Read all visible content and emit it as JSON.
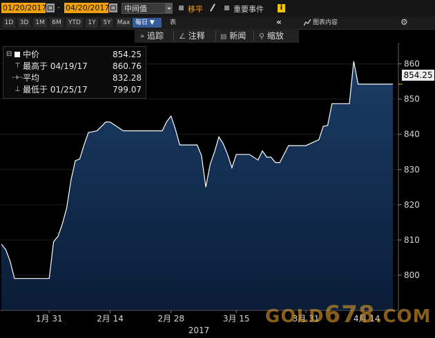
{
  "toolbar": {
    "start_date": "01/20/2017",
    "end_date": "04/20/2017",
    "dash": "-",
    "price_mode": "中间值",
    "move_label": "移平",
    "events_label": "重要事件",
    "info_label": "i"
  },
  "range_buttons": [
    "1D",
    "3D",
    "1M",
    "6M",
    "YTD",
    "1Y",
    "5Y",
    "Max"
  ],
  "period": {
    "label": "每日 ▼"
  },
  "table_btn": "表",
  "collapse_btn": "«",
  "chart_content_label": "图表内容",
  "settings_icon": "gear-icon",
  "bar3": {
    "track": "追踪",
    "annotate": "注释",
    "news": "新闻",
    "zoom": "缩放"
  },
  "legend": {
    "mid_label": "中价",
    "mid_value": "854.25",
    "high_label": "最高于 04/19/17",
    "high_value": "860.76",
    "avg_label": "平均",
    "avg_value": "832.28",
    "low_label": "最低于 01/25/17",
    "low_value": "799.07"
  },
  "price_tag": "854.25",
  "watermark": {
    "pre": "GOLD",
    "num": "678",
    "post": ".COM"
  },
  "colors": {
    "accent": "#f1a10b",
    "area_top": "#1b3d66",
    "area_bottom": "#0a1d37",
    "line": "#ffffff",
    "highlight": "#345c9a"
  },
  "chart_data": {
    "type": "area",
    "ylim": [
      790,
      866
    ],
    "yticks": [
      800,
      810,
      820,
      830,
      840,
      850,
      860
    ],
    "ytick_labels": [
      "800",
      "810",
      "820",
      "830",
      "840",
      "850",
      "860"
    ],
    "x_date_range": [
      "01/20/2017",
      "04/20/2017"
    ],
    "xticks": [
      {
        "date": "01/31/2017",
        "label": "1月 31"
      },
      {
        "date": "02/14/2017",
        "label": "2月 14"
      },
      {
        "date": "02/28/2017",
        "label": "2月 28"
      },
      {
        "date": "03/15/2017",
        "label": "3月 15"
      },
      {
        "date": "03/31/2017",
        "label": "3月 31"
      },
      {
        "date": "04/14/2017",
        "label": "4月 14"
      }
    ],
    "year_label": "2017",
    "series": [
      {
        "x": [
          "01/20/2017",
          "01/21/2017",
          "01/22/2017",
          "01/23/2017",
          "01/24/2017",
          "01/25/2017",
          "01/28/2017",
          "01/30/2017",
          "01/31/2017",
          "02/01/2017",
          "02/02/2017",
          "02/03/2017",
          "02/04/2017",
          "02/05/2017",
          "02/06/2017",
          "02/07/2017",
          "02/08/2017",
          "02/09/2017",
          "02/11/2017",
          "02/13/2017",
          "02/14/2017",
          "02/17/2017",
          "02/19/2017",
          "02/23/2017",
          "02/26/2017",
          "02/27/2017",
          "02/28/2017",
          "03/01/2017",
          "03/02/2017",
          "03/03/2017",
          "03/06/2017",
          "03/07/2017",
          "03/08/2017",
          "03/09/2017",
          "03/10/2017",
          "03/11/2017",
          "03/12/2017",
          "03/13/2017",
          "03/14/2017",
          "03/15/2017",
          "03/17/2017",
          "03/18/2017",
          "03/20/2017",
          "03/21/2017",
          "03/22/2017",
          "03/23/2017",
          "03/24/2017",
          "03/25/2017",
          "03/27/2017",
          "03/28/2017",
          "03/29/2017",
          "03/30/2017",
          "03/31/2017",
          "04/03/2017",
          "04/04/2017",
          "04/05/2017",
          "04/06/2017",
          "04/07/2017",
          "04/10/2017",
          "04/11/2017",
          "04/12/2017",
          "04/13/2017",
          "04/16/2017",
          "04/17/2017",
          "04/18/2017",
          "04/19/2017",
          "04/20/2017"
        ],
        "y": [
          808.8,
          807.3,
          804.0,
          799.07,
          799.07,
          799.07,
          799.07,
          799.07,
          799.07,
          809.5,
          811.0,
          814.5,
          819.0,
          827.0,
          832.5,
          833.0,
          837.0,
          840.5,
          841.0,
          843.5,
          843.5,
          841.0,
          841.0,
          841.0,
          841.0,
          843.6,
          845.2,
          841.5,
          837.0,
          837.0,
          837.0,
          834.0,
          825.0,
          831.5,
          835.0,
          839.3,
          837.3,
          834.3,
          830.5,
          834.3,
          834.3,
          834.3,
          832.7,
          835.3,
          833.5,
          833.5,
          832.0,
          832.0,
          836.8,
          836.8,
          836.8,
          836.8,
          836.8,
          838.5,
          842.3,
          842.5,
          848.7,
          848.7,
          848.7,
          860.76,
          854.25,
          854.25,
          854.25,
          854.25,
          854.25,
          854.25,
          854.25
        ]
      }
    ]
  }
}
